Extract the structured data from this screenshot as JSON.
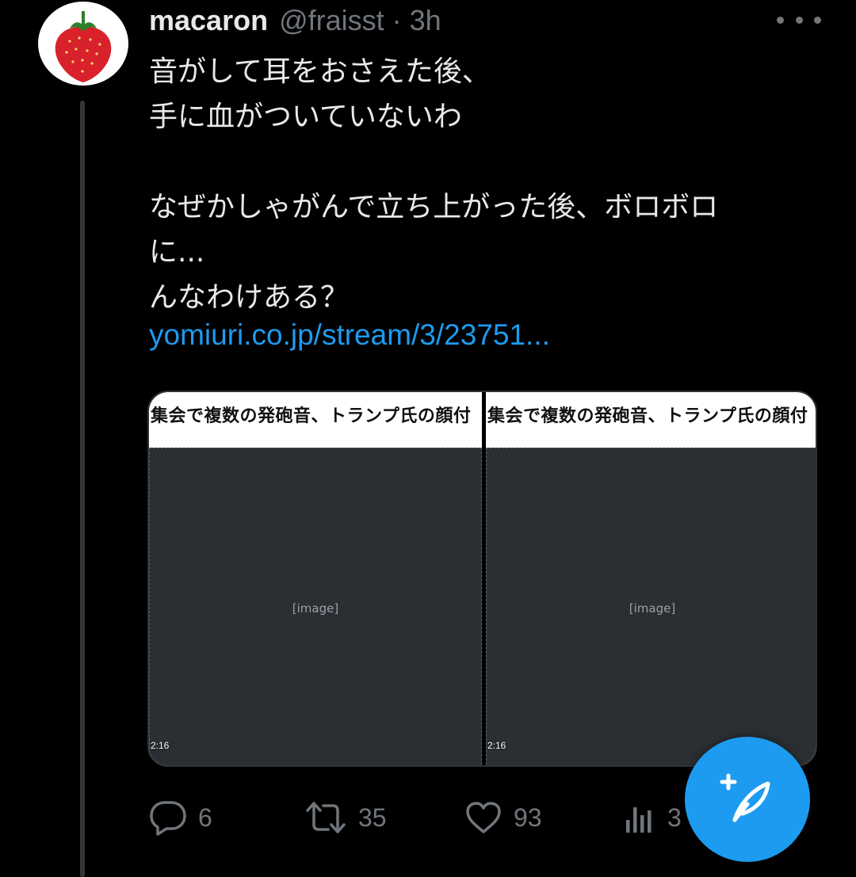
{
  "tweet": {
    "display_name": "macaron",
    "handle_time": "@fraisst · 3h",
    "text": "音がして耳をおさえた後、\n手に血がついていないわ\n\nなぜかしゃがんで立ち上がった後、ボロボロ\nに...\nんなわけある？",
    "link": "yomiuri.co.jp/stream/3/23751..."
  },
  "media": {
    "left": {
      "caption": "集会で複数の発砲音、トランプ氏の顔付",
      "timestamp": "2:16"
    },
    "right": {
      "caption": "集会で複数の発砲音、トランプ氏の顔付",
      "timestamp": "2:16"
    }
  },
  "actions": {
    "replies": "6",
    "retweets": "35",
    "likes": "93",
    "views": "3"
  },
  "icons": {
    "avatar": "strawberry-icon",
    "more": "more-icon",
    "reply": "reply-icon",
    "retweet": "retweet-icon",
    "like": "heart-icon",
    "views": "views-icon",
    "compose": "compose-tweet-icon"
  },
  "colors": {
    "background": "#000000",
    "text": "#e7e9ea",
    "secondary": "#71767b",
    "link": "#1d9bf0",
    "accent": "#1d9bf0"
  }
}
